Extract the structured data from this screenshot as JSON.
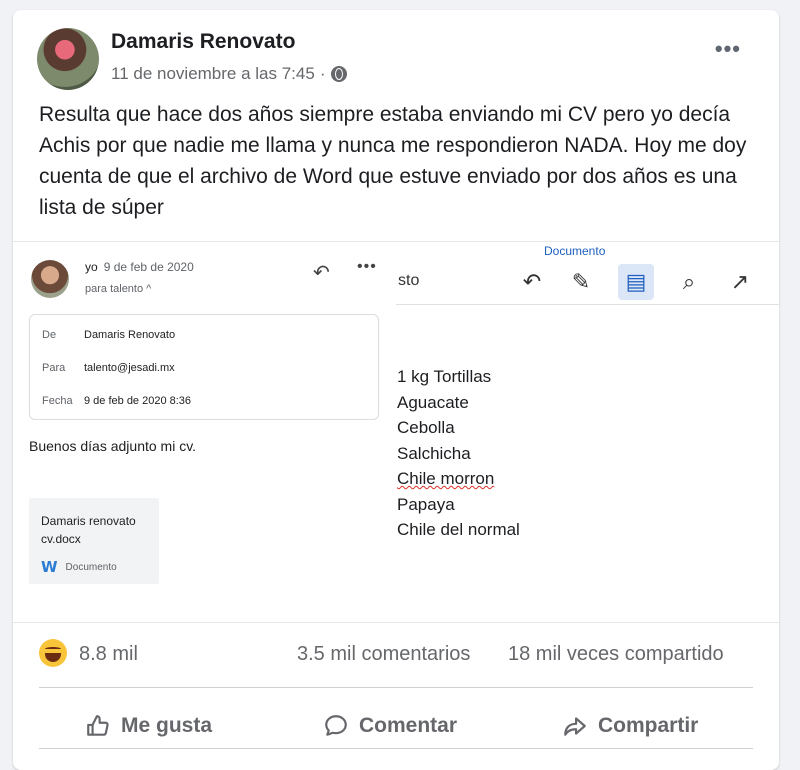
{
  "post": {
    "author": "Damaris Renovato",
    "timestamp": "11 de noviembre a las 7:45",
    "separator": "·",
    "text": "Resulta que hace dos años siempre estaba enviando mi CV pero yo decía Achis por que nadie me llama y nunca me respondieron NADA. Hoy me doy cuenta de que el archivo de Word que estuve enviado por dos años es una lista de súper",
    "icons": {
      "privacy": "globe-icon",
      "more": "more-options-icon"
    }
  },
  "email": {
    "from": "yo",
    "date": "9 de feb de 2020",
    "to": "para talento",
    "to_caret": "^",
    "details": {
      "from_label": "De",
      "from_value": "Damaris Renovato",
      "to_label": "Para",
      "to_value": "talento@jesadi.mx",
      "date_label": "Fecha",
      "date_value": "9 de feb de 2020 8:36"
    },
    "greeting": "Buenos días adjunto mi cv.",
    "attachment": {
      "name": "Damaris renovato cv.docx",
      "type": "Documento"
    }
  },
  "document": {
    "toolbar_label": "Documento",
    "toolbar_cut_text": "sto",
    "items": [
      "1 kg Tortillas",
      "Aguacate",
      "Cebolla",
      "Salchicha",
      "Chile morron",
      "Papaya",
      "Chile del normal"
    ]
  },
  "stats": {
    "reactions": "8.8 mil",
    "comments": "3.5 mil comentarios",
    "shares": "18 mil veces compartido"
  },
  "actions": {
    "like": "Me gusta",
    "comment": "Comentar",
    "share": "Compartir"
  },
  "colors": {
    "background": "#f0f2f5",
    "card": "#ffffff",
    "text": "#1c1e21",
    "secondary_text": "#65676b",
    "accent": "#1f5fbf"
  }
}
